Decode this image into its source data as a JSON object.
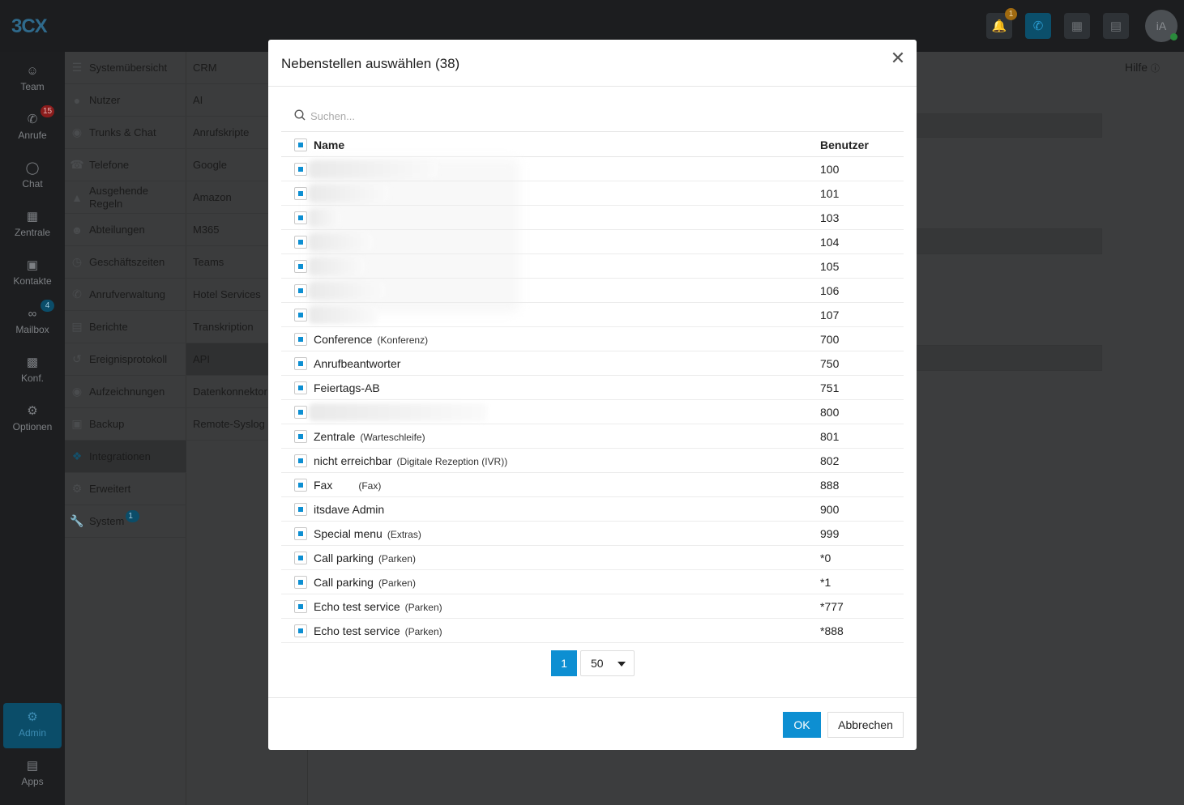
{
  "app": {
    "logo": "3CX"
  },
  "topbar": {
    "notification_count": "1",
    "avatar_initials": "iA"
  },
  "leftnav": [
    {
      "label": "Team",
      "icon": "team-icon"
    },
    {
      "label": "Anrufe",
      "icon": "phone-icon",
      "badge": "15"
    },
    {
      "label": "Chat",
      "icon": "chat-icon"
    },
    {
      "label": "Zentrale",
      "icon": "switchboard-icon"
    },
    {
      "label": "Kontakte",
      "icon": "contacts-icon"
    },
    {
      "label": "Mailbox",
      "icon": "voicemail-icon",
      "badge": "4"
    },
    {
      "label": "Konf.",
      "icon": "video-icon"
    },
    {
      "label": "Optionen",
      "icon": "gear-icon"
    }
  ],
  "leftnav_bottom": {
    "admin": "Admin",
    "apps": "Apps"
  },
  "settings_menu": [
    "Systemübersicht",
    "Nutzer",
    "Trunks & Chat",
    "Telefone",
    "Ausgehende Regeln",
    "Abteilungen",
    "Geschäftszeiten",
    "Anrufverwaltung",
    "Berichte",
    "Ereignisprotokoll",
    "Aufzeichnungen",
    "Backup",
    "Integrationen",
    "Erweitert",
    "System"
  ],
  "settings_menu_system_badge": "1",
  "integrations_menu": [
    "CRM",
    "AI",
    "Anrufskripte",
    "Google",
    "Amazon",
    "M365",
    "Teams",
    "Hotel Services",
    "Transkription",
    "API",
    "Datenkonnektor",
    "Remote-Syslog"
  ],
  "help_label": "Hilfe",
  "modal": {
    "title": "Nebenstellen auswählen (38)",
    "search_placeholder": "Suchen...",
    "col_name": "Name",
    "col_user": "Benutzer",
    "rows": [
      {
        "name": "",
        "type": "",
        "ext": "100"
      },
      {
        "name": "",
        "type": "",
        "ext": "101"
      },
      {
        "name": "",
        "type": "",
        "ext": "103"
      },
      {
        "name": "",
        "type": "",
        "ext": "104"
      },
      {
        "name": "",
        "type": "",
        "ext": "105"
      },
      {
        "name": "",
        "type": "",
        "ext": "106"
      },
      {
        "name": "",
        "type": "",
        "ext": "107"
      },
      {
        "name": "Conference",
        "type": "(Konferenz)",
        "ext": "700"
      },
      {
        "name": "Anrufbeantworter",
        "type": "",
        "ext": "750"
      },
      {
        "name": "Feiertags-AB",
        "type": "",
        "ext": "751"
      },
      {
        "name": "",
        "type": "",
        "ext": "800"
      },
      {
        "name": "Zentrale",
        "type": "(Warteschleife)",
        "ext": "801"
      },
      {
        "name": "nicht erreichbar",
        "type": "(Digitale Rezeption (IVR))",
        "ext": "802"
      },
      {
        "name": "Fax",
        "type": "(Fax)",
        "ext": "888"
      },
      {
        "name": "itsdave Admin",
        "type": "",
        "ext": "900"
      },
      {
        "name": "Special menu",
        "type": "(Extras)",
        "ext": "999"
      },
      {
        "name": "Call parking",
        "type": "(Parken)",
        "ext": "*0"
      },
      {
        "name": "Call parking",
        "type": "(Parken)",
        "ext": "*1"
      },
      {
        "name": "Echo test service",
        "type": "(Parken)",
        "ext": "*777"
      },
      {
        "name": "Echo test service",
        "type": "(Parken)",
        "ext": "*888"
      }
    ],
    "page": "1",
    "page_size": "50",
    "ok": "OK",
    "cancel": "Abbrechen"
  }
}
